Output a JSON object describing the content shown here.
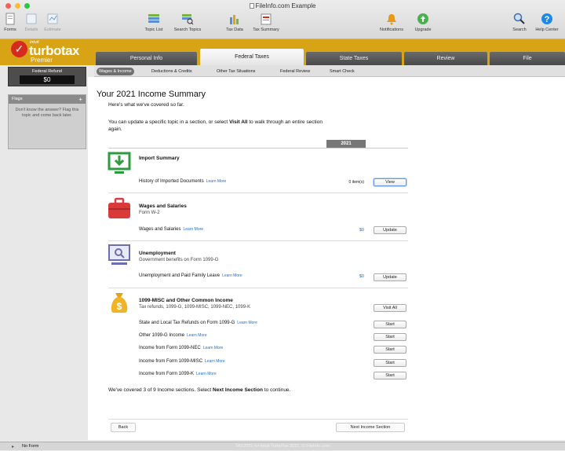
{
  "window": {
    "title": "FileInfo.com Example"
  },
  "toolbar": {
    "forms": "Forms",
    "details": "Details",
    "estimate": "Estimate",
    "topic_list": "Topic List",
    "search_topics": "Search Topics",
    "tax_data": "Tax Data",
    "tax_summary": "Tax Summary",
    "notifications": "Notifications",
    "upgrade": "Upgrade",
    "search": "Search",
    "help_center": "Help Center"
  },
  "brand": {
    "intuit": "intuit",
    "name": "turbotax",
    "edition": "Premier"
  },
  "tabs": [
    "Personal Info",
    "Federal Taxes",
    "State Taxes",
    "Review",
    "File"
  ],
  "subtabs": [
    "Wages & Income",
    "Deductions & Credits",
    "Other Tax Situations",
    "Federal Review",
    "Smart Check"
  ],
  "sidebar": {
    "refund_label": "Federal Refund",
    "refund_amount": "$0",
    "flags_label": "Flags",
    "flags_add": "+",
    "flags_text": "Don't know the answer? Flag this topic and come back later."
  },
  "page": {
    "title": "Your 2021 Income Summary",
    "intro1": "Here's what we've covered so far.",
    "intro2_pre": "You can update a specific topic in a section, or select ",
    "intro2_bold": "Visit All",
    "intro2_post": " to walk through an entire section",
    "intro2_line2": "again.",
    "year": "2021"
  },
  "sections": {
    "import": {
      "title": "Import Summary",
      "row": "History of Imported Documents",
      "learn": "Learn More",
      "value": "0 item(s)",
      "button": "View"
    },
    "wages": {
      "title": "Wages and Salaries",
      "subtitle": "Form W-2",
      "row": "Wages and Salaries",
      "learn": "Learn More",
      "value": "$0",
      "button": "Update"
    },
    "unemployment": {
      "title": "Unemployment",
      "subtitle": "Government benefits on Form 1099-G",
      "row": "Unemployment and Paid Family Leave",
      "learn": "Learn More",
      "value": "$0",
      "button": "Update"
    },
    "misc": {
      "title": "1099-MISC and Other Common Income",
      "subtitle": "Tax refunds, 1099-G, 1099-MISC, 1099-NEC, 1099-K",
      "visit_all": "Visit All",
      "rows": [
        {
          "label": "State and Local Tax Refunds on Form 1099-G",
          "learn": "Learn More",
          "button": "Start"
        },
        {
          "label": "Other 1099-G Income",
          "learn": "Learn More",
          "button": "Start"
        },
        {
          "label": "Income from Form 1099-NEC",
          "learn": "Learn More",
          "button": "Start"
        },
        {
          "label": "Income from Form 1099-MISC",
          "learn": "Learn More",
          "button": "Start"
        },
        {
          "label": "Income from Form 1099-K",
          "learn": "Learn More",
          "button": "Start"
        }
      ]
    }
  },
  "footer": {
    "covered_pre": "We've covered 3 of 9 Income sections. Select ",
    "covered_bold": "Next Income Section",
    "covered_post": " to continue.",
    "back": "Back",
    "next": "Next Income Section"
  },
  "status": {
    "form": "No Form",
    "copyright": "TAX2021 for intuit TurboTax 2021, © FileInfo.com"
  },
  "colors": {
    "brand": "#d9a316",
    "green": "#2e9b3e",
    "red": "#d52b1e",
    "link": "#1a6fd0"
  }
}
